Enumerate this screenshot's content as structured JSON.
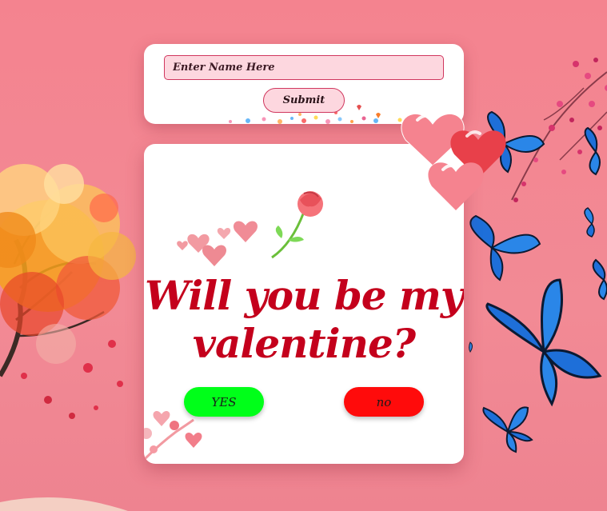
{
  "form": {
    "name_placeholder": "Enter Name Here",
    "name_value": "",
    "submit_label": "Submit"
  },
  "card": {
    "question_line1": "Will you be my",
    "question_line2": "valentine?",
    "yes_label": "YES",
    "no_label": "no"
  },
  "colors": {
    "background": "#f4838f",
    "question": "#c4001c",
    "yes_button": "#00ff19",
    "no_button": "#ff0b0b",
    "input_fill": "#fdd7df",
    "input_border": "#d0375e"
  },
  "decorations": {
    "icons": [
      "heart-icon",
      "rose-icon",
      "butterfly-icon",
      "autumn-tree-icon",
      "cherry-blossom-icon"
    ]
  }
}
